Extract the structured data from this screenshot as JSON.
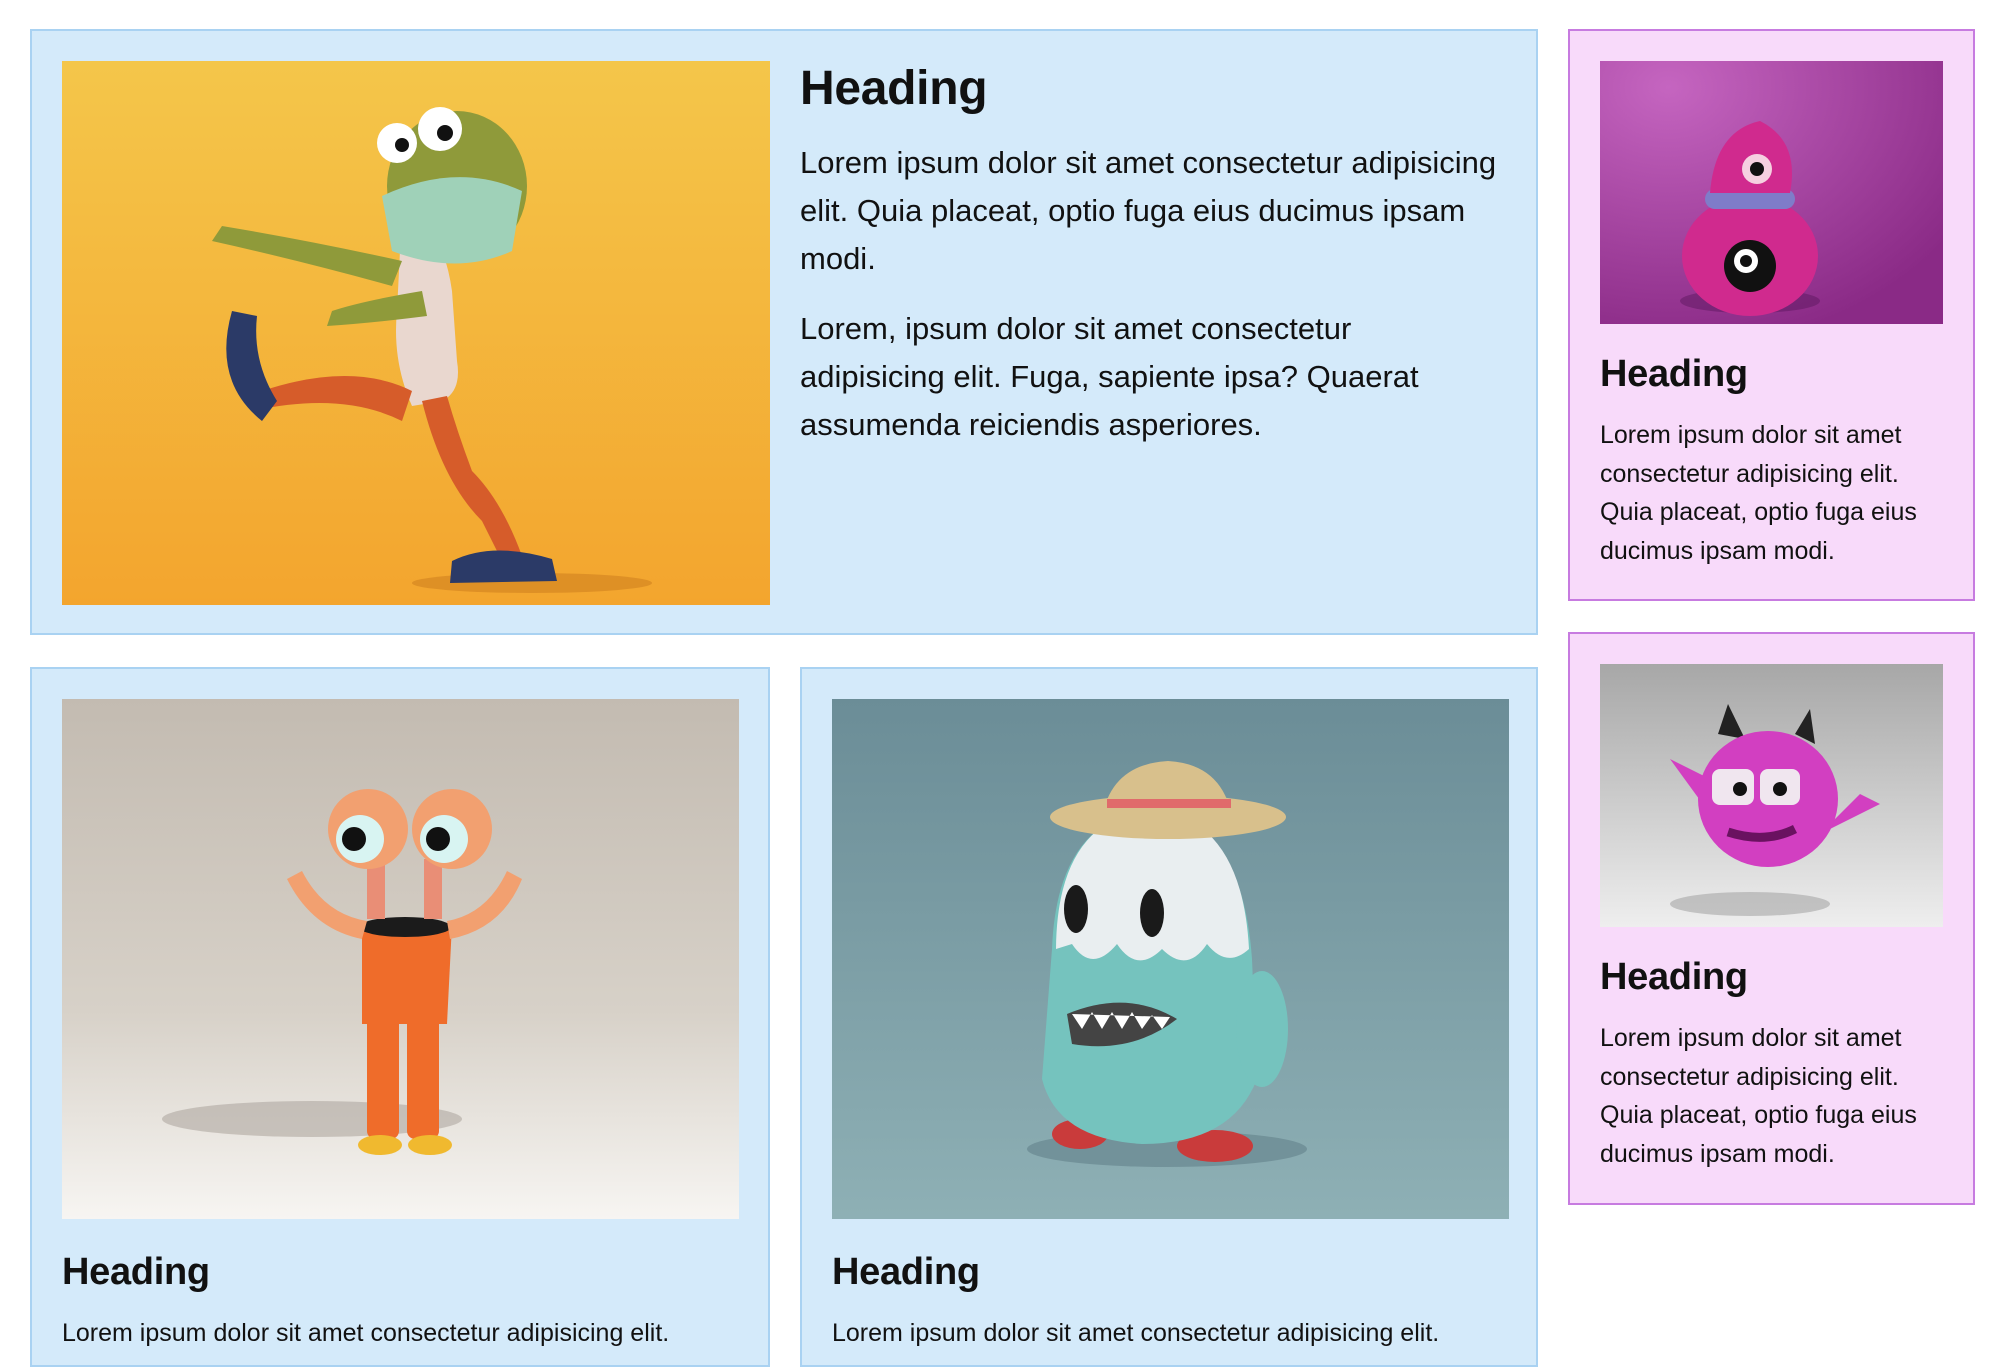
{
  "cards": {
    "feature": {
      "heading": "Heading",
      "paragraph1": "Lorem ipsum dolor sit amet consectetur adipisicing elit. Quia placeat, optio fuga eius ducimus ipsam modi.",
      "paragraph2": "Lorem, ipsum dolor sit amet consectetur adipisicing elit. Fuga, sapiente ipsa? Quaerat assumenda reiciendis asperiores.",
      "image": "zombie-monster-illustration"
    },
    "side_top": {
      "heading": "Heading",
      "paragraph": "Lorem ipsum dolor sit amet consectetur adipisicing elit. Quia placeat, optio fuga eius ducimus ipsam modi.",
      "image": "pink-cyclops-monster-illustration"
    },
    "side_bottom": {
      "heading": "Heading",
      "paragraph": "Lorem ipsum dolor sit amet consectetur adipisicing elit. Quia placeat, optio fuga eius ducimus ipsam modi.",
      "image": "pink-devil-monster-illustration"
    },
    "bottom_left": {
      "heading": "Heading",
      "paragraph": "Lorem ipsum dolor sit amet consectetur adipisicing elit.",
      "image": "eyeball-robot-monster-illustration"
    },
    "bottom_mid": {
      "heading": "Heading",
      "paragraph": "Lorem ipsum dolor sit amet consectetur adipisicing elit.",
      "image": "teal-ghost-monster-illustration"
    }
  },
  "colors": {
    "blue_card_bg": "#d4eafa",
    "blue_card_border": "#a9d2f2",
    "pink_card_bg": "#f8dafa",
    "pink_card_border": "#c77be0"
  }
}
